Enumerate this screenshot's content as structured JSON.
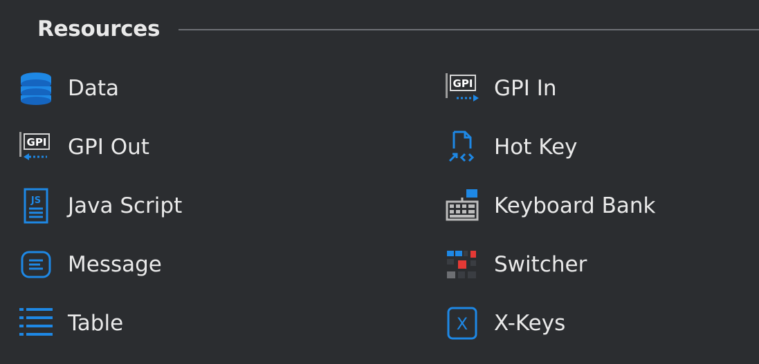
{
  "group": {
    "title": "Resources"
  },
  "items": [
    {
      "label": "Data",
      "icon": "database-icon"
    },
    {
      "label": "GPI In",
      "icon": "gpi-in-icon"
    },
    {
      "label": "GPI Out",
      "icon": "gpi-out-icon"
    },
    {
      "label": "Hot Key",
      "icon": "hot-key-icon"
    },
    {
      "label": "Java Script",
      "icon": "javascript-file-icon"
    },
    {
      "label": "Keyboard Bank",
      "icon": "keyboard-bank-icon"
    },
    {
      "label": "Message",
      "icon": "message-icon"
    },
    {
      "label": "Switcher",
      "icon": "switcher-icon"
    },
    {
      "label": "Table",
      "icon": "table-list-icon"
    },
    {
      "label": "X-Keys",
      "icon": "x-keys-icon"
    }
  ],
  "colors": {
    "background": "#2b2d30",
    "accent_blue": "#1e88e5",
    "accent_red": "#e53935",
    "text": "#eaeaea"
  }
}
